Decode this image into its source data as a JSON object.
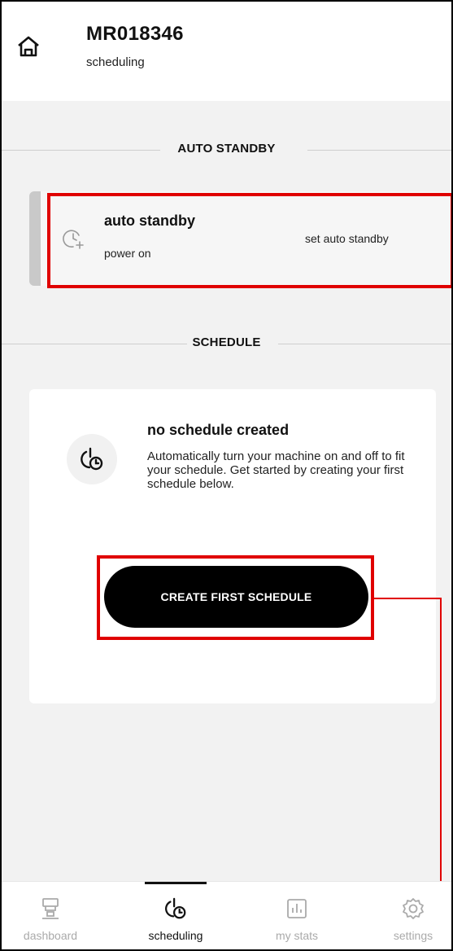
{
  "header": {
    "machine_id": "MR018346",
    "subtitle": "scheduling",
    "home_icon": "home-icon"
  },
  "auto_standby_section": {
    "heading": "AUTO STANDBY",
    "card": {
      "title": "auto standby",
      "subtitle": "power on",
      "action_label": "set auto standby",
      "icon": "clock-plus-icon"
    }
  },
  "schedule_section": {
    "heading": "SCHEDULE",
    "empty_state": {
      "title": "no schedule created",
      "description": "Automatically turn your machine on and off to fit your schedule. Get started by creating your first schedule below.",
      "icon": "power-clock-icon"
    },
    "create_button_label": "CREATE FIRST SCHEDULE"
  },
  "tabbar": {
    "active": "scheduling",
    "tabs": [
      {
        "label": "dashboard",
        "icon": "espresso-machine-icon"
      },
      {
        "label": "scheduling",
        "icon": "power-clock-icon"
      },
      {
        "label": "my stats",
        "icon": "bar-chart-icon"
      },
      {
        "label": "settings",
        "icon": "gear-icon"
      }
    ]
  },
  "colors": {
    "highlight": "#e00000",
    "primary_button": "#000000",
    "background": "#f2f2f2"
  }
}
